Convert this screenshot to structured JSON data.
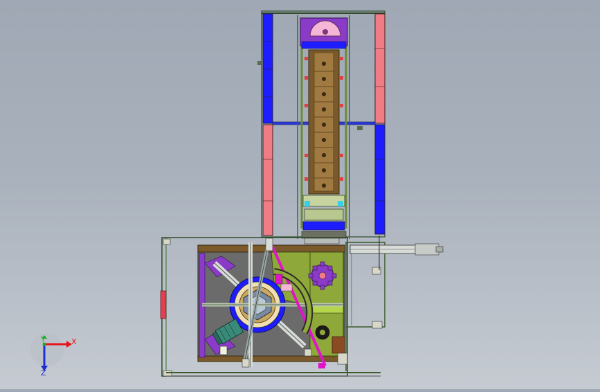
{
  "axes": {
    "x_label": "X",
    "y_label": "Y",
    "z_label": "Z",
    "x_color": "#e8141c",
    "y_color": "#1faa2a",
    "z_color": "#1a2fd6"
  },
  "palette": {
    "background_top": "#9fa8b4",
    "background_bottom": "#c6cbd2",
    "frame_line": "#3a5a2a",
    "blue_panel": "#1d1dff",
    "pink_panel": "#f07d86",
    "dark_gray": "#6b6b6b",
    "purple": "#8a3cc8",
    "olive_green": "#8fa83a",
    "lime": "#b5d64c",
    "magenta": "#e014c8",
    "cyan": "#36d0e8",
    "brown": "#7a5a2a",
    "light_pink": "#f6b6d6"
  }
}
